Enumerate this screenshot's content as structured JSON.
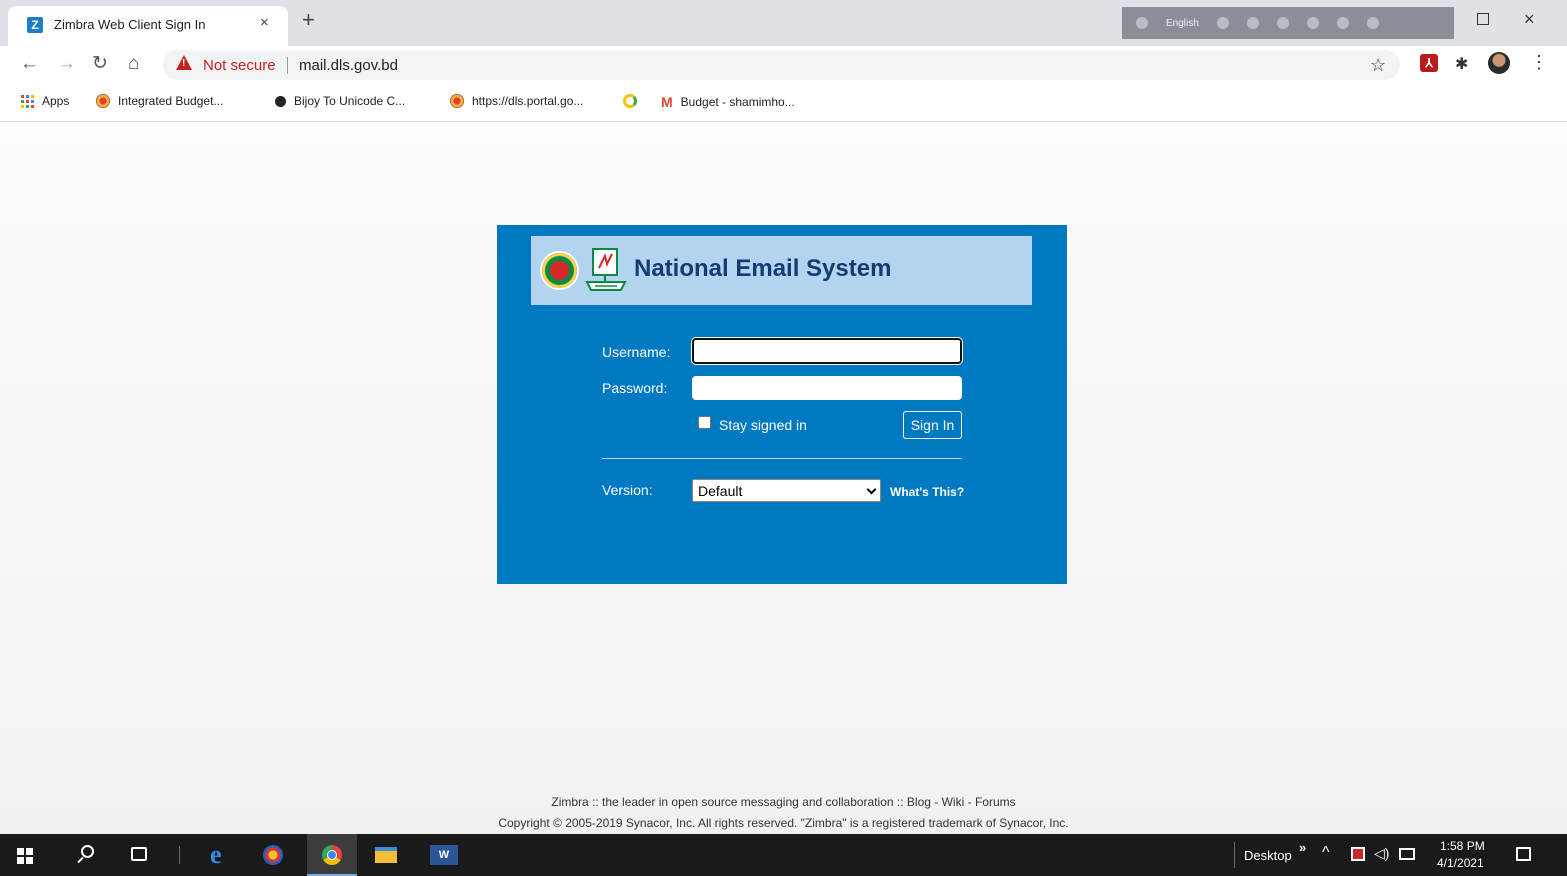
{
  "browser": {
    "tab_title": "Zimbra Web Client Sign In",
    "tab_favicon": "Z",
    "tab_close": "×",
    "new_tab": "+",
    "extension_lang": "English",
    "window_close": "×",
    "security_label": "Not secure",
    "url": "mail.dls.gov.bd",
    "bookmarks": [
      {
        "label": "Apps",
        "icon": "apps-grid-icon"
      },
      {
        "label": "Integrated Budget...",
        "icon": "portal-icon"
      },
      {
        "label": "Bijoy To Unicode C...",
        "icon": "circle-icon"
      },
      {
        "label": "https://dls.portal.go...",
        "icon": "portal-icon"
      },
      {
        "label": "",
        "icon": "ring-icon"
      },
      {
        "label": "Budget - shamimho...",
        "icon": "gmail-icon"
      }
    ]
  },
  "login": {
    "banner_title": "National Email System",
    "username_label": "Username:",
    "username_value": "",
    "password_label": "Password:",
    "password_value": "",
    "stay_signed_in_label": "Stay signed in",
    "stay_signed_in_checked": false,
    "signin_label": "Sign In",
    "version_label": "Version:",
    "version_selected": "Default",
    "whats_this_label": "What's This?"
  },
  "footer": {
    "line1_prefix": "Zimbra :: the leader in open source messaging and collaboration :: ",
    "blog": "Blog",
    "wiki": "Wiki",
    "forums": "Forums",
    "sep": " - ",
    "copyright": "Copyright © 2005-2019 Synacor, Inc. All rights reserved. \"Zimbra\" is a registered trademark of Synacor, Inc."
  },
  "taskbar": {
    "desktop_label": "Desktop",
    "more": "»",
    "time": "1:58 PM",
    "date": "4/1/2021",
    "word_letter": "W"
  },
  "colors": {
    "panel_blue": "#0079c3",
    "banner_bg": "#b2d4ee",
    "title_navy": "#153c72",
    "warning_red": "#c5221f"
  }
}
